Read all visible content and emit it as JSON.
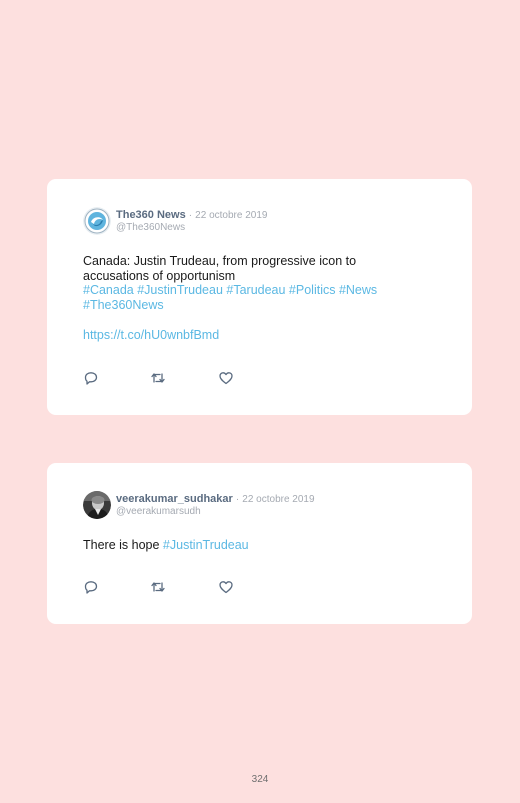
{
  "tweets": [
    {
      "author_name": "The360 News",
      "separator": "·",
      "date": "22 octobre 2019",
      "handle": "@The360News",
      "text": "Canada: Justin Trudeau, from progressive icon to accusations of opportunism",
      "hashtags": "#Canada #JustinTrudeau #Tarudeau #Politics #News #The360News",
      "link": "https://t.co/hU0wnbfBmd",
      "avatar_icon": "the360-news-logo",
      "actions": [
        "reply-icon",
        "retweet-icon",
        "like-icon"
      ]
    },
    {
      "author_name": "veerakumar_sudhakar",
      "separator": "·",
      "date": "22 octobre 2019",
      "handle": "@veerakumarsudh",
      "text": "There is hope",
      "hashtags": "#JustinTrudeau",
      "avatar_icon": "user-photo",
      "actions": [
        "reply-icon",
        "retweet-icon",
        "like-icon"
      ]
    }
  ],
  "page_number": "324",
  "colors": {
    "background": "#fde0df",
    "card": "#ffffff",
    "link": "#5bb8e3",
    "name": "#5a6b80",
    "meta": "#a5aab2",
    "icon": "#5a6b80"
  }
}
